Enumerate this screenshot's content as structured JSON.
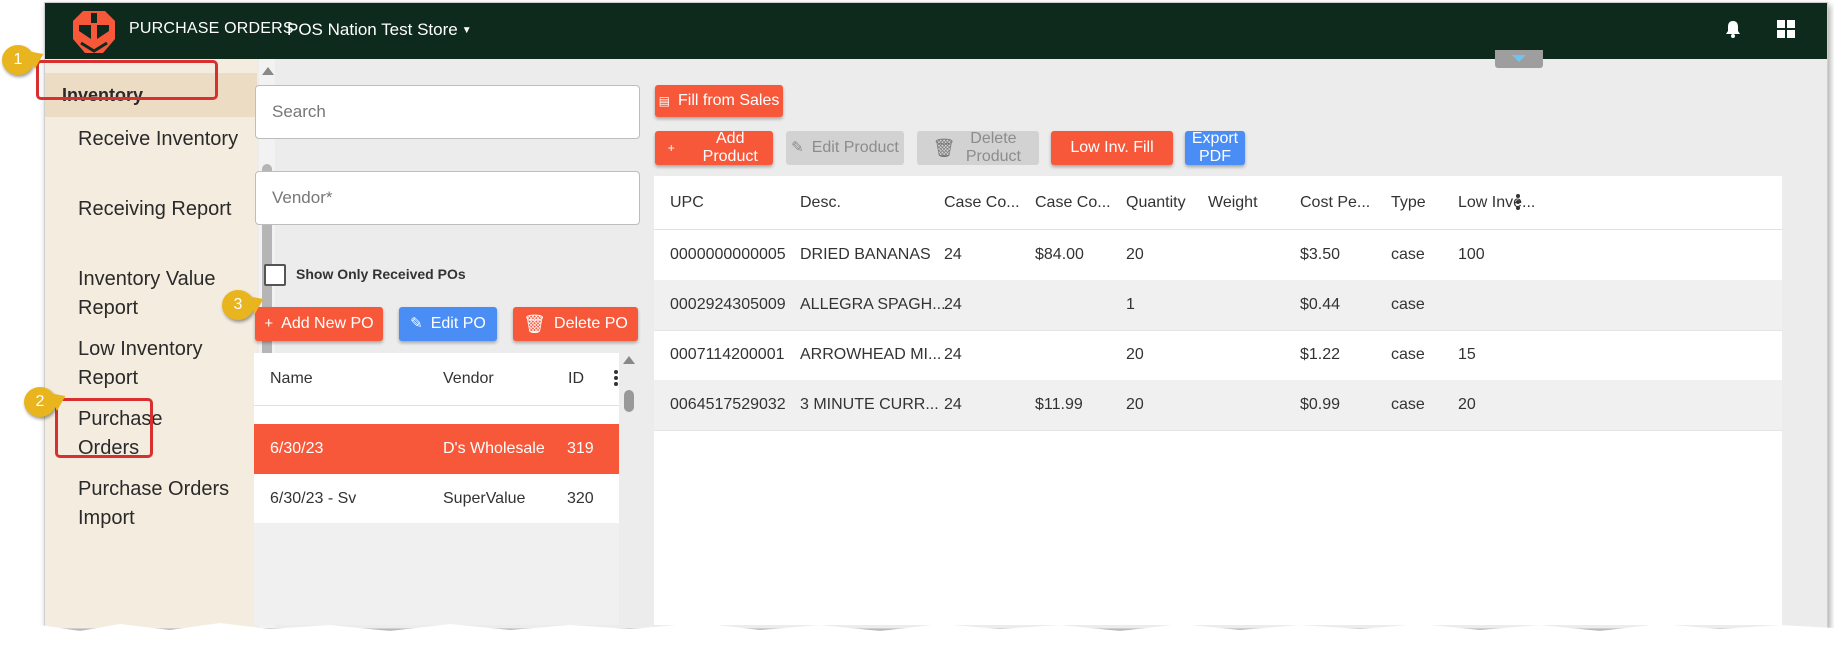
{
  "header": {
    "app_title": "PURCHASE ORDERS",
    "store_name": "POS Nation Test Store"
  },
  "sidebar": {
    "section": "Inventory",
    "items": [
      {
        "label": "Receive Inventory"
      },
      {
        "label": "Receiving Report"
      },
      {
        "label": "Inventory Value Report"
      },
      {
        "label": "Low Inventory Report"
      },
      {
        "label": "Purchase Orders"
      },
      {
        "label": "Purchase Orders Import"
      }
    ]
  },
  "callouts": [
    "1",
    "2",
    "3"
  ],
  "po_panel": {
    "search_placeholder": "Search",
    "vendor_placeholder": "Vendor*",
    "show_received_label": "Show Only Received POs",
    "add_label": "Add New PO",
    "edit_label": "Edit PO",
    "delete_label": "Delete PO",
    "columns": [
      "Name",
      "Vendor",
      "ID"
    ],
    "rows": [
      {
        "name": "6/30/23",
        "vendor": "D's Wholesale",
        "id": "319"
      },
      {
        "name": "6/30/23 - Sv",
        "vendor": "SuperValue",
        "id": "320"
      }
    ]
  },
  "toolbar": {
    "fill_from_sales": "Fill from Sales",
    "add_product": "Add Product",
    "edit_product": "Edit Product",
    "delete_product": "Delete Product",
    "low_inv_fill": "Low Inv. Fill",
    "export_pdf": "Export PDF"
  },
  "products": {
    "columns": [
      "UPC",
      "Desc.",
      "Case Co...",
      "Case Co...",
      "Quantity",
      "Weight",
      "Cost Pe...",
      "Type",
      "Low Inve..."
    ],
    "rows": [
      [
        "0000000000005",
        "DRIED BANANAS",
        "24",
        "$84.00",
        "20",
        "",
        "$3.50",
        "case",
        "100"
      ],
      [
        "0002924305009",
        "ALLEGRA SPAGH...",
        "24",
        "",
        "1",
        "",
        "$0.44",
        "case",
        ""
      ],
      [
        "0007114200001",
        "ARROWHEAD MI...",
        "24",
        "",
        "20",
        "",
        "$1.22",
        "case",
        "15"
      ],
      [
        "0064517529032",
        "3 MINUTE CURR...",
        "24",
        "$11.99",
        "20",
        "",
        "$0.99",
        "case",
        "20"
      ]
    ]
  },
  "colors": {
    "header_bg": "#0e2a1d",
    "accent_orange": "#f8583a",
    "accent_blue": "#4a8df5",
    "sidebar_bg": "#f4ecdf",
    "callout": "#e8b51f",
    "highlight": "#d92f2f"
  }
}
